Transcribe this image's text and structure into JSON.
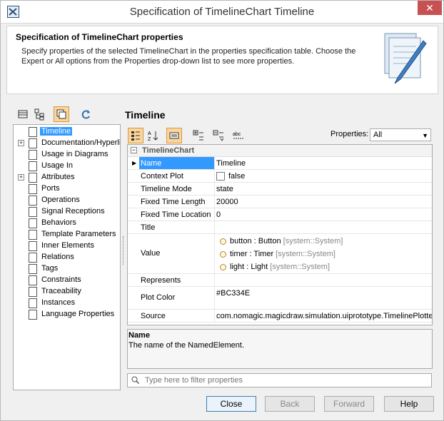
{
  "window": {
    "title": "Specification of TimelineChart Timeline",
    "close_glyph": "✕"
  },
  "header": {
    "title": "Specification of TimelineChart properties",
    "description": "Specify properties of the selected TimelineChart in the properties specification table. Choose the Expert or All options from the Properties drop-down list to see more properties."
  },
  "tree": {
    "items": [
      {
        "label": "Timeline",
        "expander": "",
        "selected": true
      },
      {
        "label": "Documentation/Hyperlinks",
        "expander": "+"
      },
      {
        "label": "Usage in Diagrams",
        "expander": ""
      },
      {
        "label": "Usage In",
        "expander": ""
      },
      {
        "label": "Attributes",
        "expander": "+"
      },
      {
        "label": "Ports",
        "expander": ""
      },
      {
        "label": "Operations",
        "expander": ""
      },
      {
        "label": "Signal Receptions",
        "expander": ""
      },
      {
        "label": "Behaviors",
        "expander": ""
      },
      {
        "label": "Template Parameters",
        "expander": ""
      },
      {
        "label": "Inner Elements",
        "expander": ""
      },
      {
        "label": "Relations",
        "expander": ""
      },
      {
        "label": "Tags",
        "expander": ""
      },
      {
        "label": "Constraints",
        "expander": ""
      },
      {
        "label": "Traceability",
        "expander": ""
      },
      {
        "label": "Instances",
        "expander": ""
      },
      {
        "label": "Language Properties",
        "expander": ""
      }
    ]
  },
  "right_panel": {
    "title": "Timeline",
    "properties_label": "Properties:",
    "properties_value": "All"
  },
  "grid": {
    "group": "TimelineChart",
    "group_expander": "−",
    "rows": {
      "name": {
        "label": "Name",
        "value": "Timeline"
      },
      "context_plot": {
        "label": "Context Plot",
        "value": "false"
      },
      "timeline_mode": {
        "label": "Timeline Mode",
        "value": "state"
      },
      "fixed_time_length": {
        "label": "Fixed Time Length",
        "value": "20000"
      },
      "fixed_time_location": {
        "label": "Fixed Time Location",
        "value": "0"
      },
      "title": {
        "label": "Title",
        "value": ""
      },
      "value": {
        "label": "Value"
      },
      "represents": {
        "label": "Represents",
        "value": ""
      },
      "plot_color": {
        "label": "Plot Color",
        "value": "#BC334E"
      },
      "source": {
        "label": "Source",
        "value": "com.nomagic.magicdraw.simulation.uiprototype.TimelinePlotter"
      }
    },
    "value_items": [
      {
        "name": "button",
        "type": " : Button",
        "qualifier": " [system::System]"
      },
      {
        "name": "timer",
        "type": " : Timer",
        "qualifier": " [system::System]"
      },
      {
        "name": "light",
        "type": " : Light",
        "qualifier": " [system::System]"
      }
    ]
  },
  "description": {
    "title": "Name",
    "text": "The name of the NamedElement."
  },
  "filter": {
    "placeholder": "Type here to filter properties"
  },
  "buttons": {
    "close": "Close",
    "back": "Back",
    "forward": "Forward",
    "help": "Help"
  }
}
